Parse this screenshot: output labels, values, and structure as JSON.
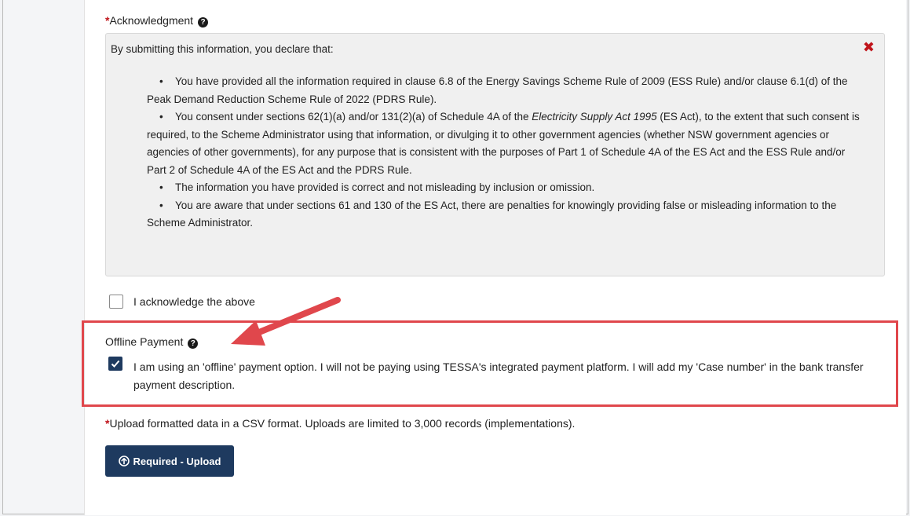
{
  "acknowledgment": {
    "label": "Acknowledgment",
    "required_marker": "*",
    "help_icon": "question-circle-icon",
    "intro": "By submitting this information, you declare that:",
    "close_icon": "close-x-icon",
    "bullets": {
      "b1": "You have provided all the information required in clause 6.8 of the Energy Savings Scheme Rule of 2009 (ESS Rule) and/or clause 6.1(d) of the Peak Demand Reduction Scheme Rule of 2022 (PDRS Rule).",
      "b2_pre": "You consent under sections 62(1)(a) and/or 131(2)(a) of Schedule 4A of the ",
      "b2_italic": "Electricity Supply Act 1995",
      "b2_post": " (ES Act), to the extent that such consent is required, to the Scheme Administrator using that information, or divulging it to other government agencies (whether NSW government agencies or agencies of other governments), for any purpose that is consistent with the purposes of Part 1 of Schedule 4A of the ES Act and the ESS Rule and/or Part 2 of Schedule 4A of the ES Act and the PDRS Rule.",
      "b3": "The information you have provided is correct and not misleading by inclusion or omission.",
      "b4": "You are aware that under sections 61 and 130 of the ES Act, there are penalties for knowingly providing false or misleading information to the Scheme Administrator."
    },
    "bullet_char": "•",
    "checkbox_label": "I acknowledge the above",
    "checked": false
  },
  "offline_payment": {
    "label": "Offline Payment",
    "help_icon": "question-circle-icon",
    "checkbox_label": "I am using an 'offline' payment option. I will not be paying using TESSA's integrated payment platform. I will add my 'Case number' in the bank transfer payment description.",
    "checked": true
  },
  "upload": {
    "required_marker": "*",
    "instruction": "Upload formatted data in a CSV format. Uploads are limited to 3,000 records (implementations).",
    "button_label": "Required - Upload",
    "button_icon": "arrow-up-circle-icon"
  },
  "colors": {
    "accent": "#1e3a5f",
    "required": "#c0141b",
    "annotation": "#e0474c"
  }
}
